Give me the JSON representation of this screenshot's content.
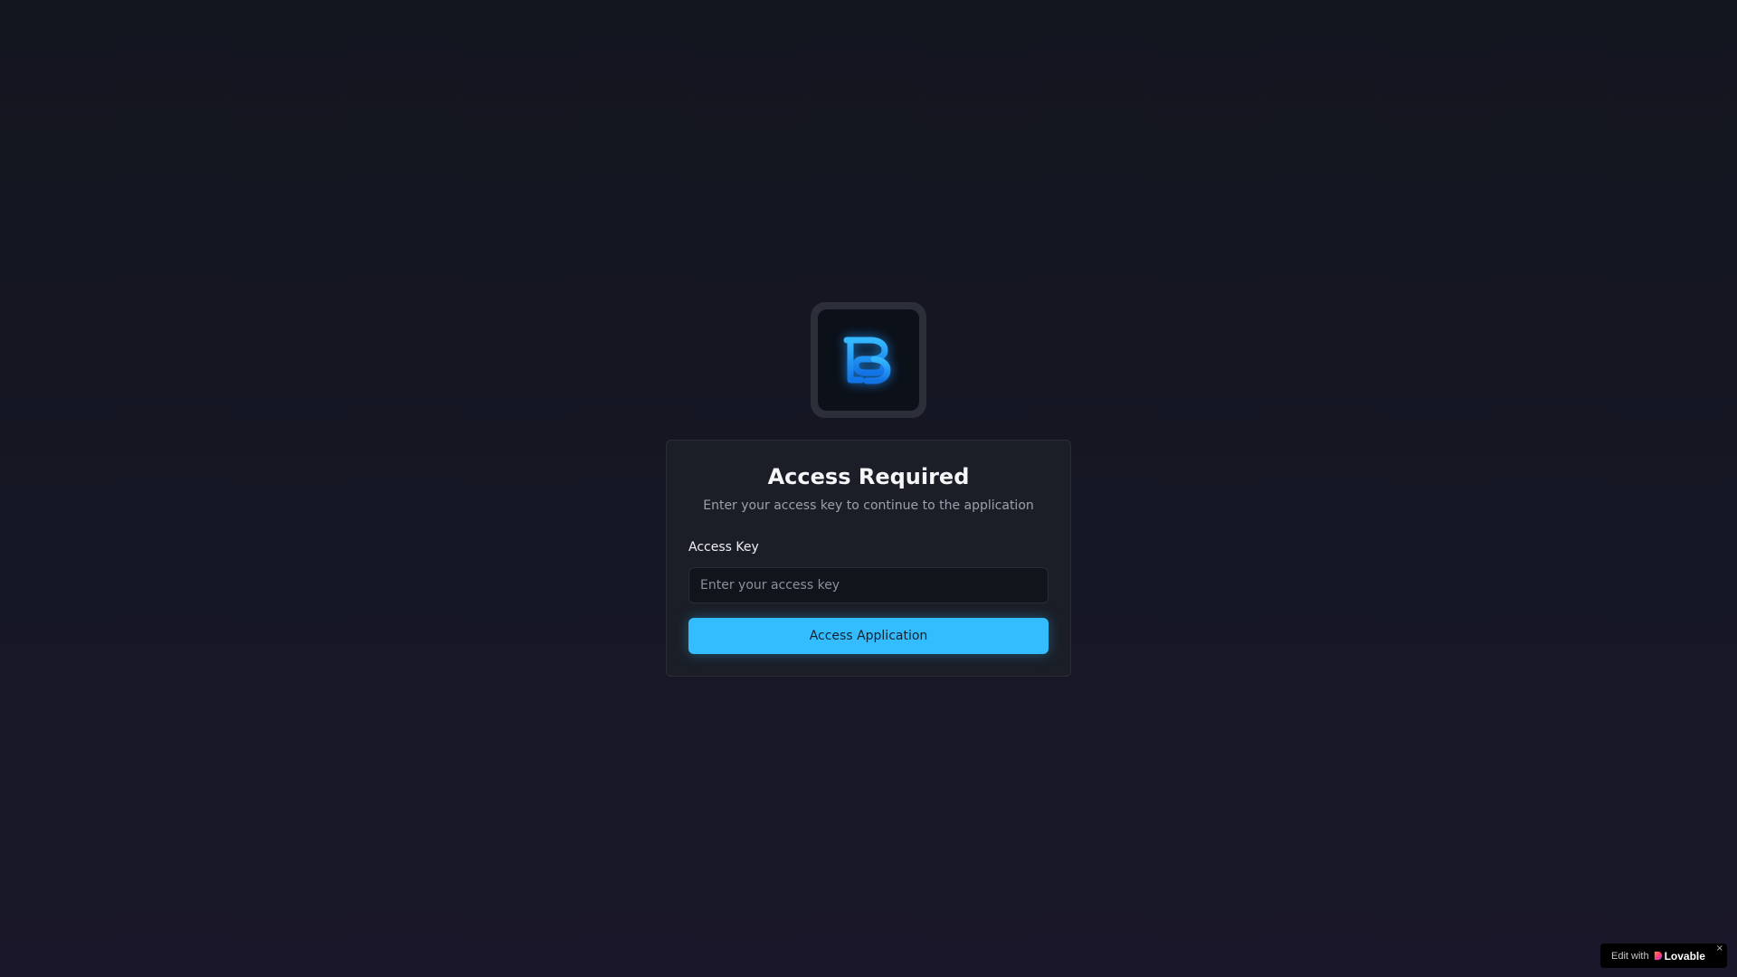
{
  "logo": {
    "icon": "brand-b-logo-icon",
    "accent_color": "#1ea0ff"
  },
  "login": {
    "title": "Access Required",
    "subtitle": "Enter your access key to continue to the application",
    "field_label": "Access Key",
    "field_placeholder": "Enter your access key",
    "field_value": "",
    "submit_label": "Access Application",
    "button_color": "#33bdff"
  },
  "badge": {
    "prefix": "Edit with",
    "brand": "Lovable",
    "close": "×"
  }
}
